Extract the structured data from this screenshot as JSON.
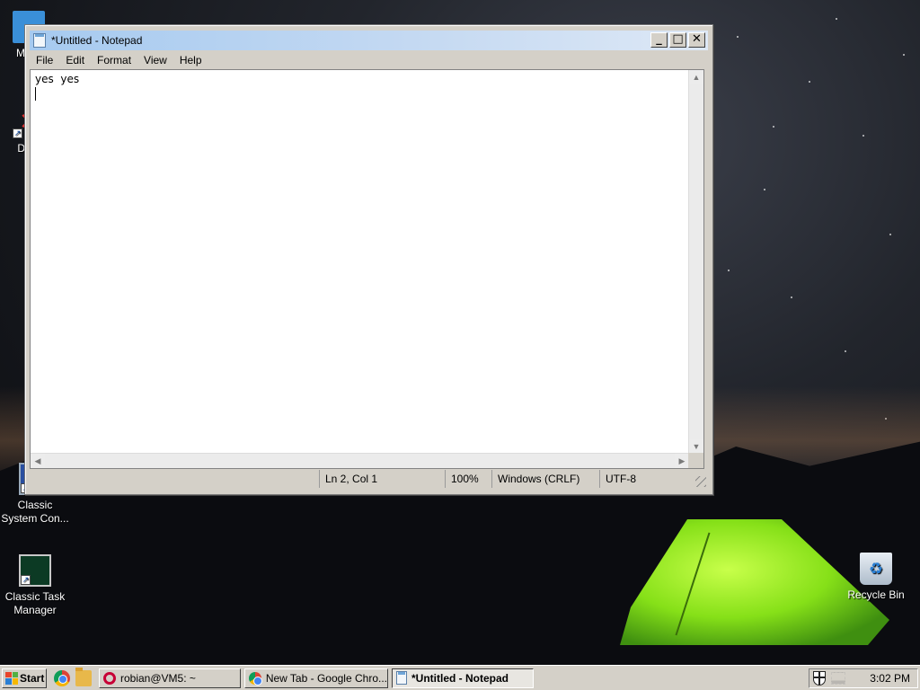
{
  "desktop": {
    "icons": [
      {
        "label": "My C"
      },
      {
        "label": "Data"
      },
      {
        "label": "Classic System Con..."
      },
      {
        "label": "Classic Task Manager"
      },
      {
        "label": "Recycle Bin"
      }
    ]
  },
  "window": {
    "title": "*Untitled - Notepad",
    "minimize": "_",
    "maximize": "□",
    "close": "✕",
    "menu": [
      "File",
      "Edit",
      "Format",
      "View",
      "Help"
    ],
    "editor_text": "yes  yes",
    "status": {
      "position": "Ln 2, Col 1",
      "zoom": "100%",
      "line_ending": "Windows (CRLF)",
      "encoding": "UTF-8"
    }
  },
  "taskbar": {
    "start_label": "Start",
    "tasks": [
      {
        "label": "robian@VM5: ~",
        "icon": "debian-icon"
      },
      {
        "label": "New Tab - Google Chro...",
        "icon": "chrome-icon"
      },
      {
        "label": "*Untitled - Notepad",
        "icon": "notepad-icon",
        "active": true
      }
    ],
    "clock": "3:02 PM"
  },
  "colors": {
    "titlebar": "#a6caf0",
    "face": "#d4d0c8",
    "tent": "#86e018"
  }
}
